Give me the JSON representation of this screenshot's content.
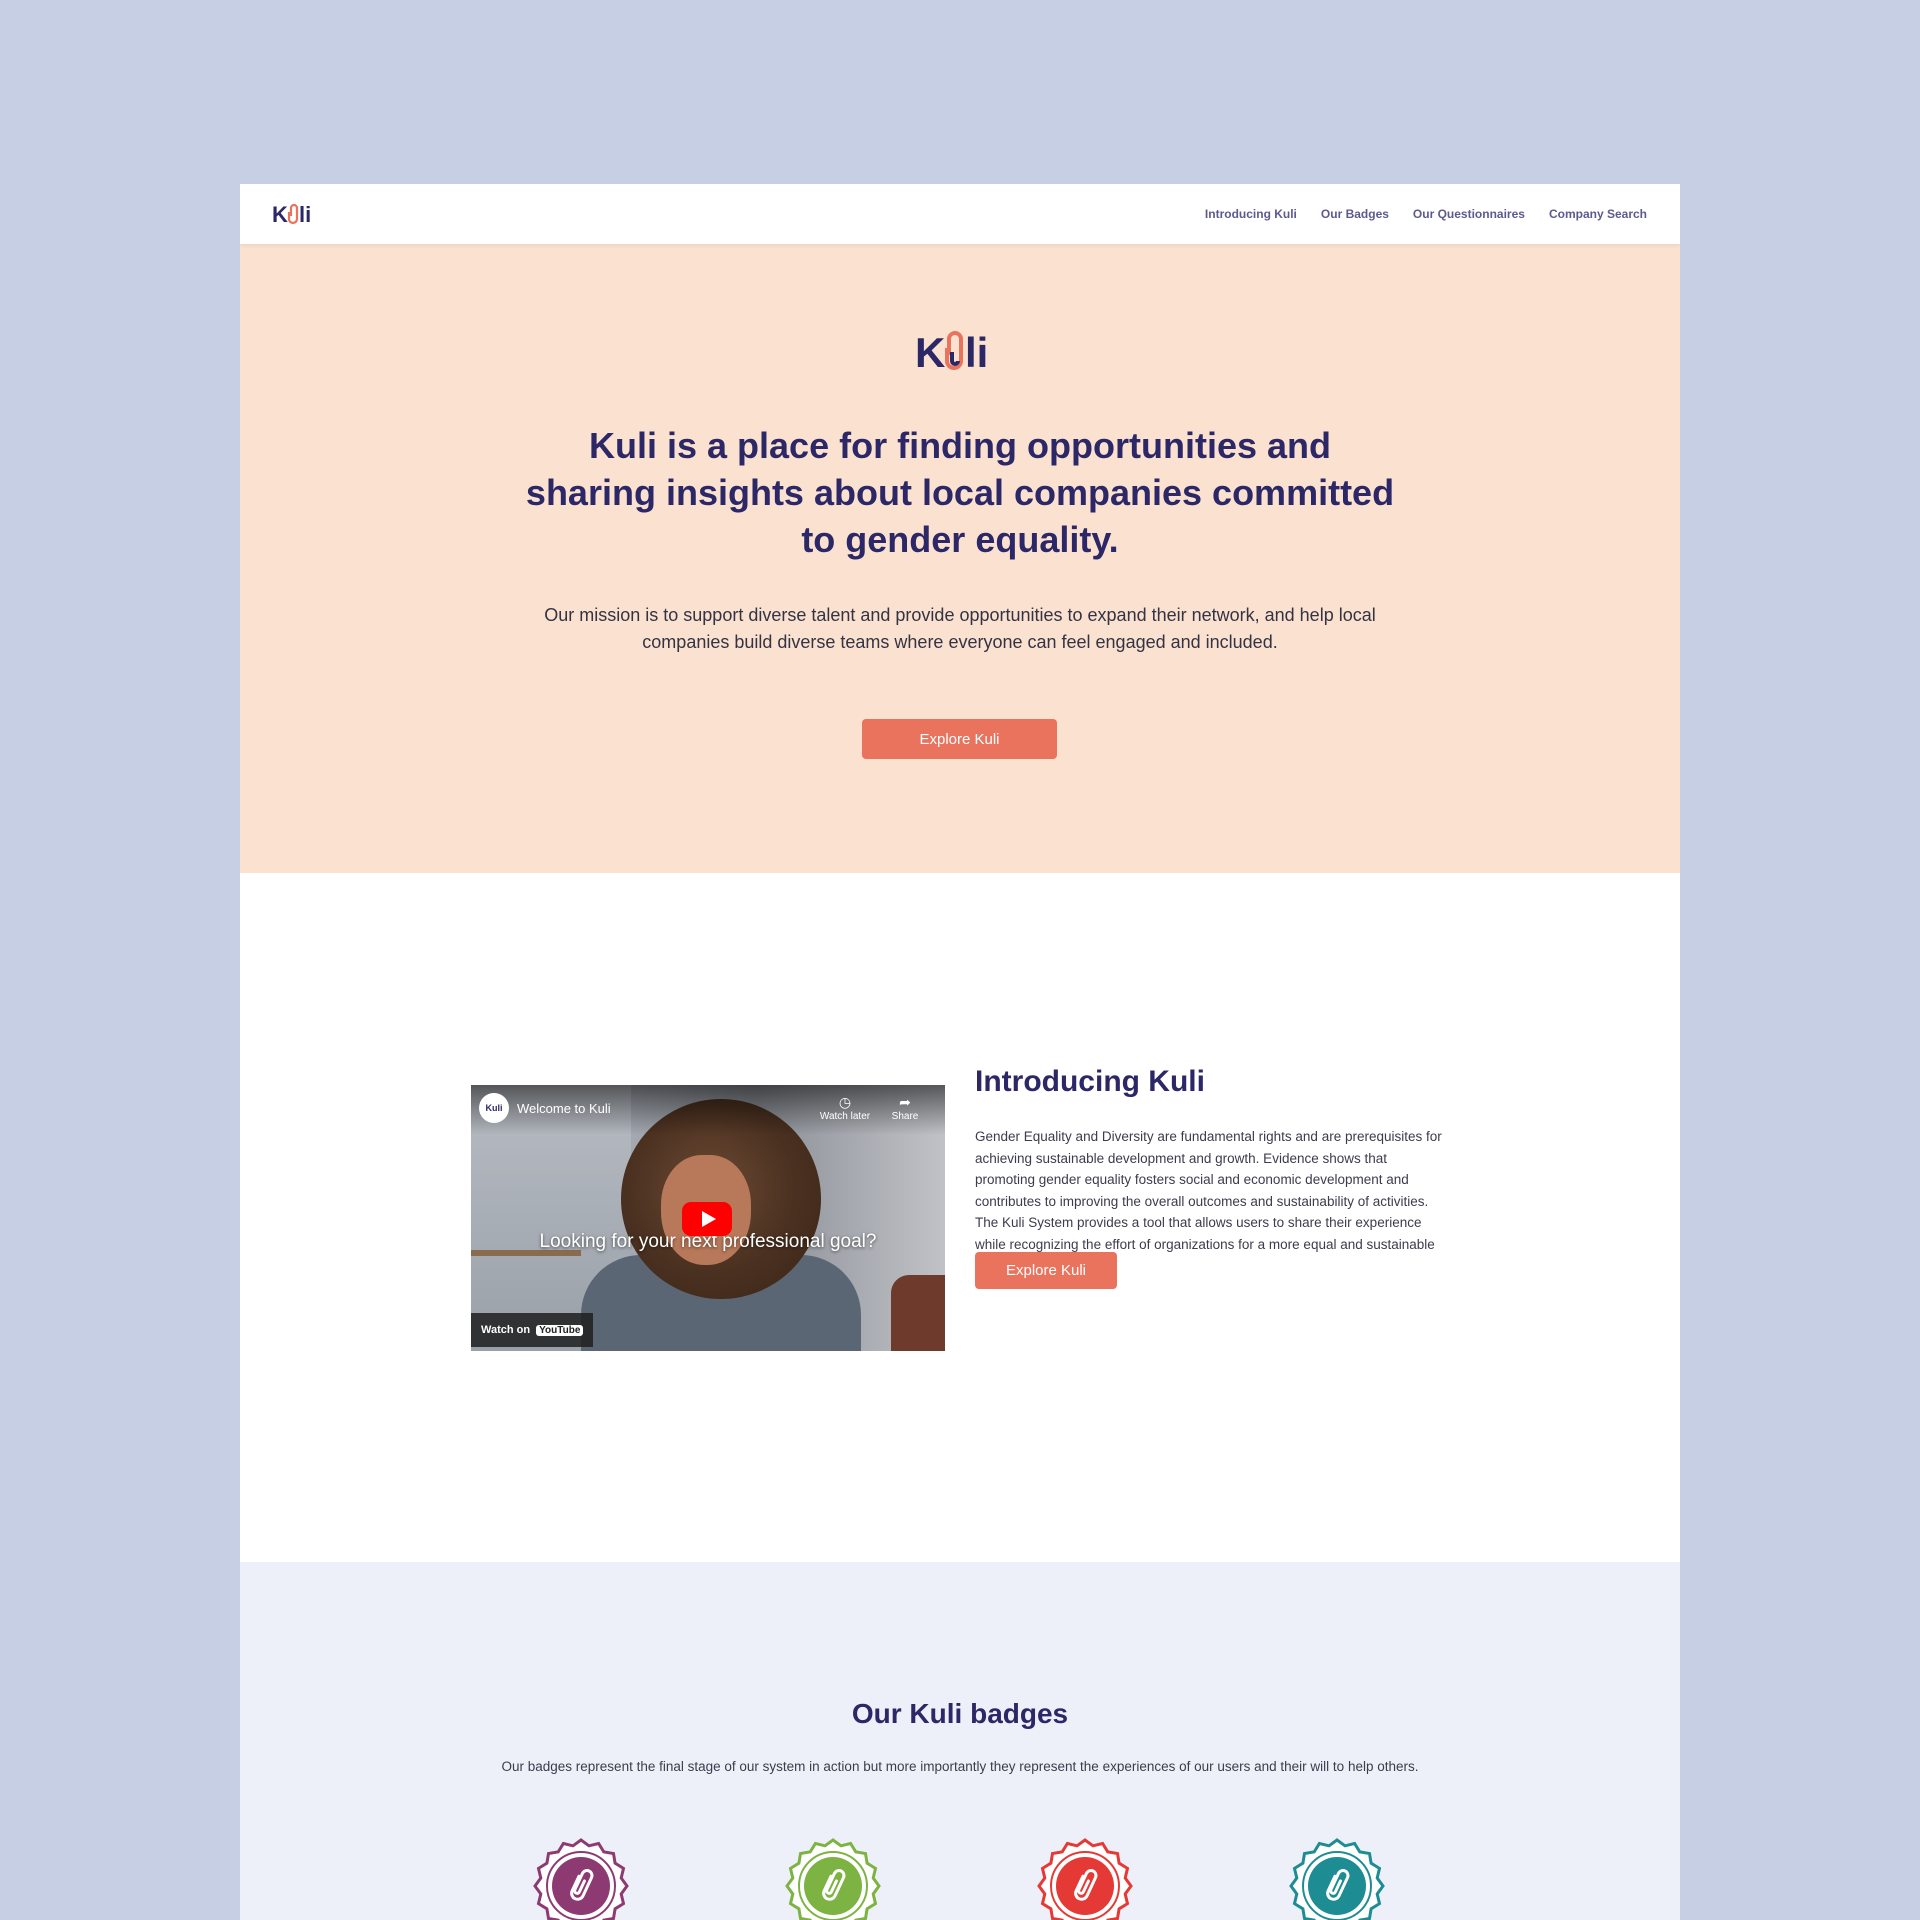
{
  "brand": {
    "name": "Kuli"
  },
  "nav": {
    "items": [
      "Introducing Kuli",
      "Our Badges",
      "Our Questionnaires",
      "Company Search"
    ]
  },
  "hero": {
    "headline": "Kuli is a place for finding opportunities and sharing insights about local companies committed to gender equality.",
    "mission": "Our mission is to support diverse talent and provide opportunities to expand their network, and help local companies build diverse teams where everyone can feel engaged and included.",
    "cta_label": "Explore Kuli"
  },
  "intro": {
    "video": {
      "channel_logo": "Kuli",
      "title": "Welcome to Kuli",
      "watch_later_label": "Watch later",
      "share_label": "Share",
      "caption": "Looking for your next professional goal?",
      "watch_on_label": "Watch on",
      "youtube_label": "YouTube"
    },
    "heading": "Introducing Kuli",
    "body": "Gender Equality and Diversity are fundamental rights and are prerequisites for achieving sustainable development and growth. Evidence shows that promoting gender equality fosters social and economic development and contributes to improving the overall outcomes and sustainability of activities. The Kuli System provides a tool that allows users to share their experience while recognizing the effort of organizations for a more equal and sustainable society.",
    "cta_label": "Explore Kuli"
  },
  "badges": {
    "heading": "Our Kuli badges",
    "description": "Our badges represent the final stage of our system in action but more importantly they represent the experiences of our users and their will to help others.",
    "items": [
      {
        "icon": "paperclip-badge-icon",
        "color": "#8e3a72"
      },
      {
        "icon": "paperclip-badge-icon",
        "color": "#7cb342"
      },
      {
        "icon": "paperclip-badge-icon",
        "color": "#e53935"
      },
      {
        "icon": "paperclip-badge-icon",
        "color": "#1e8c93"
      }
    ]
  },
  "colors": {
    "page_bg": "#c6cfe4",
    "primary_text": "#2c2766",
    "accent": "#ea735e",
    "hero_bg": "#fbe2d0",
    "badges_bg": "#edf0f9"
  }
}
